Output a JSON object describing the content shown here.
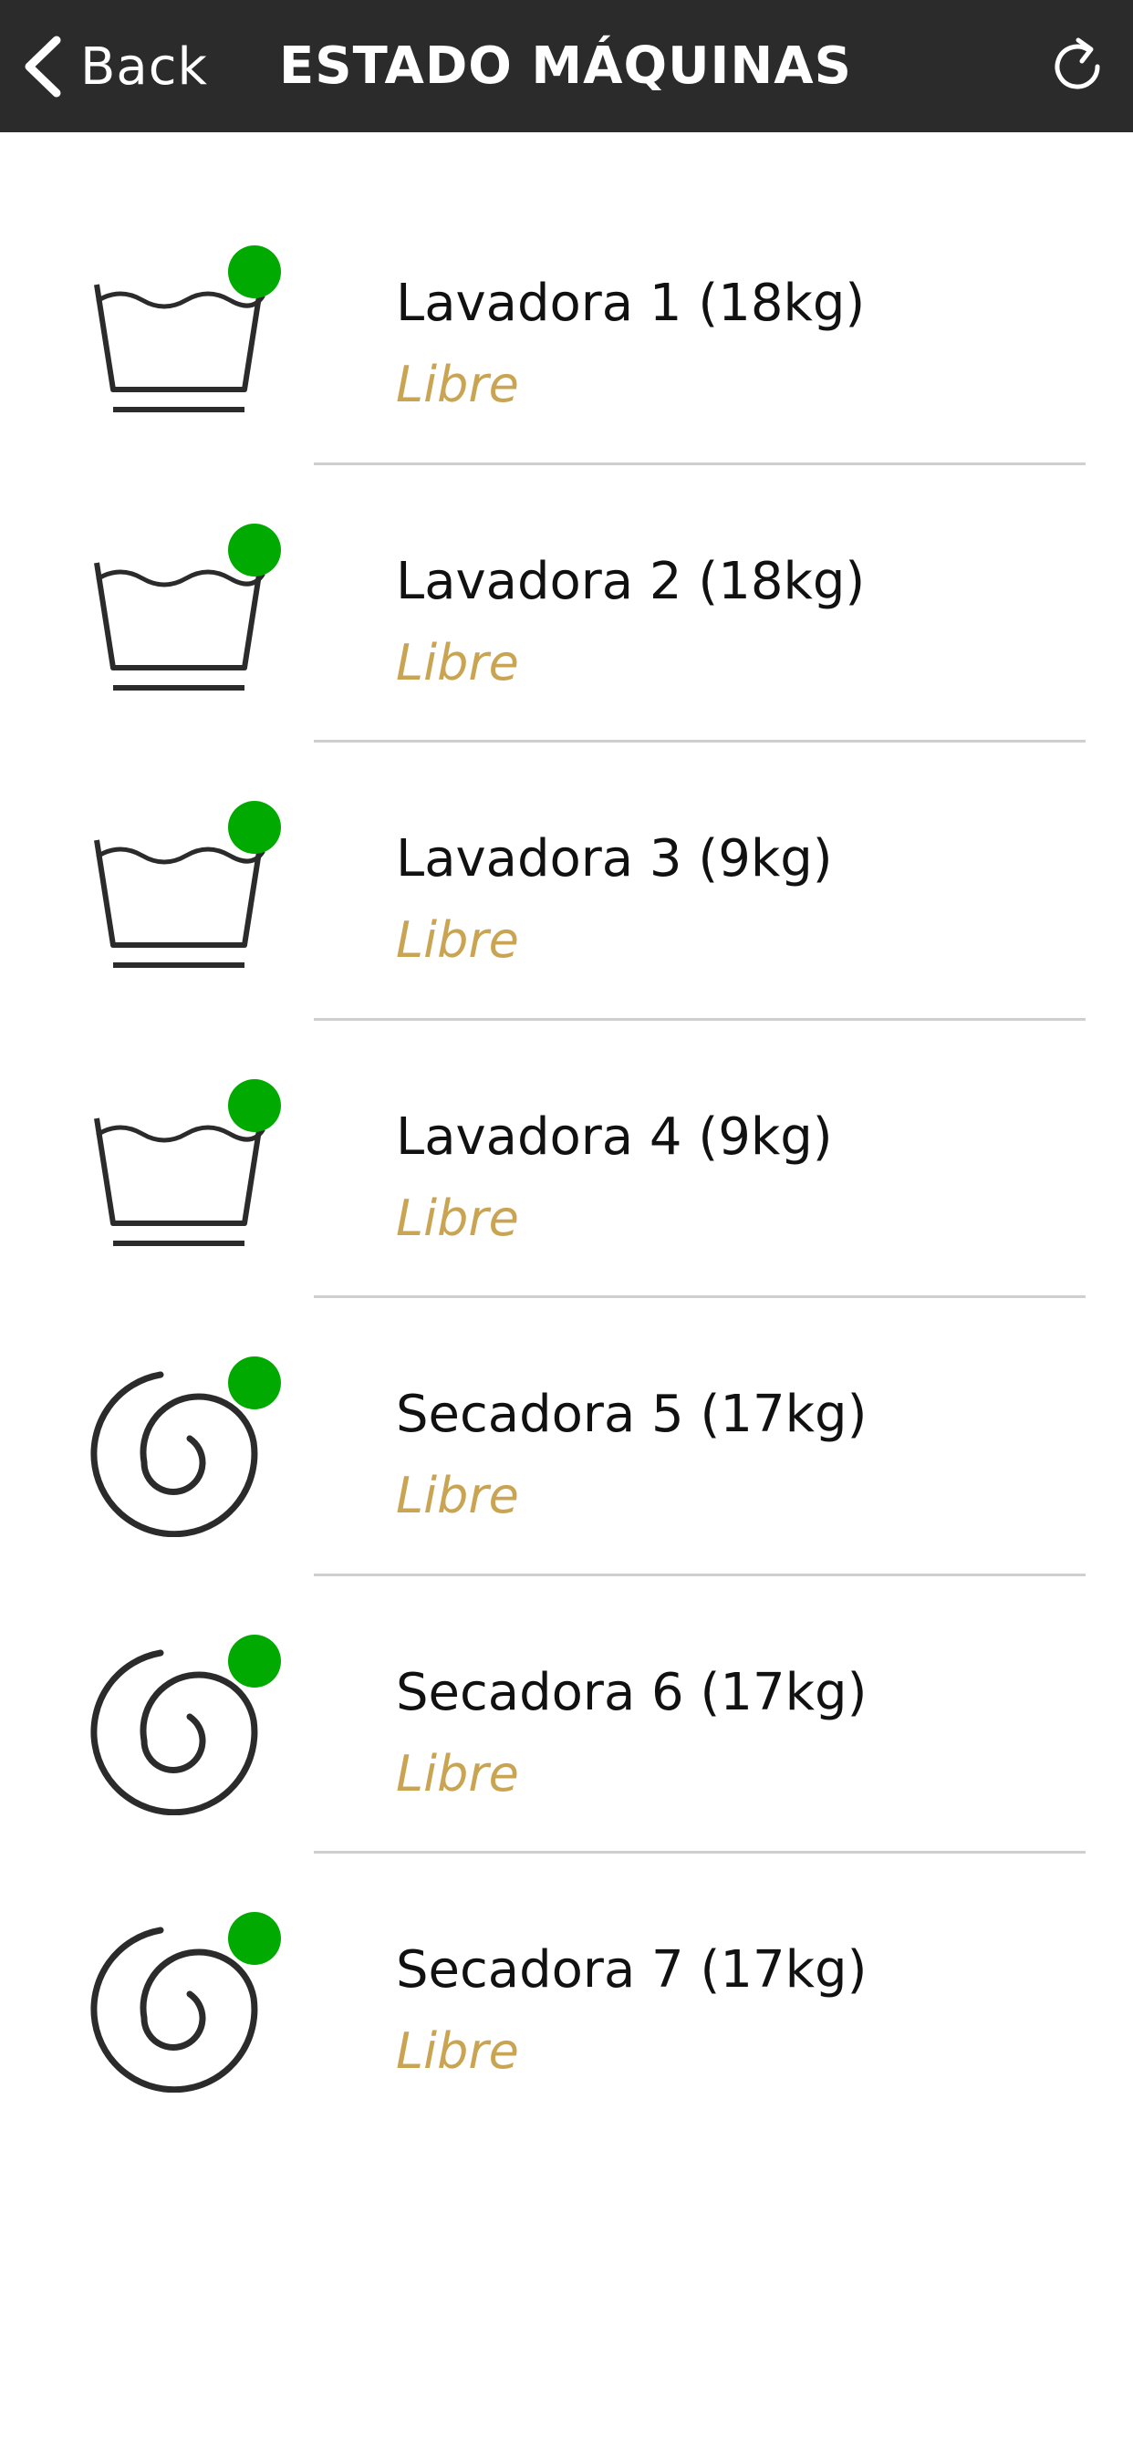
{
  "header": {
    "back_label": "Back",
    "title": "ESTADO MÁQUINAS",
    "back_icon": "chevron-left-icon",
    "refresh_icon": "refresh-icon"
  },
  "colors": {
    "header_bg": "#2b2b2b",
    "status_free": "#00aa00",
    "status_text": "#c9a553",
    "divider": "#cfcfcf"
  },
  "machines": [
    {
      "name": "Lavadora 1 (18kg)",
      "status": "Libre",
      "icon": "washer-icon"
    },
    {
      "name": "Lavadora 2 (18kg)",
      "status": "Libre",
      "icon": "washer-icon"
    },
    {
      "name": "Lavadora 3 (9kg)",
      "status": "Libre",
      "icon": "washer-icon"
    },
    {
      "name": "Lavadora 4 (9kg)",
      "status": "Libre",
      "icon": "washer-icon"
    },
    {
      "name": "Secadora 5 (17kg)",
      "status": "Libre",
      "icon": "dryer-icon"
    },
    {
      "name": "Secadora 6 (17kg)",
      "status": "Libre",
      "icon": "dryer-icon"
    },
    {
      "name": "Secadora 7 (17kg)",
      "status": "Libre",
      "icon": "dryer-icon"
    }
  ]
}
